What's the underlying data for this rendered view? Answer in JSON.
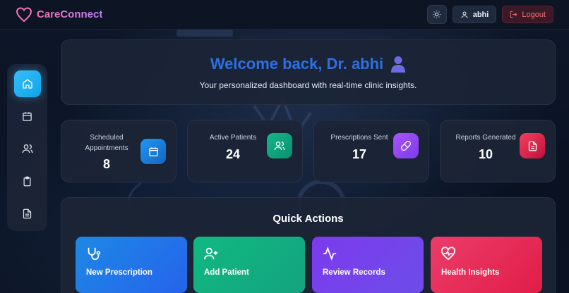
{
  "header": {
    "brand": "CareConnect",
    "user_label": "abhi",
    "logout_label": "Logout"
  },
  "sidebar": {
    "items": [
      {
        "icon": "home-icon",
        "active": true
      },
      {
        "icon": "calendar-icon",
        "active": false
      },
      {
        "icon": "users-icon",
        "active": false
      },
      {
        "icon": "clipboard-icon",
        "active": false
      },
      {
        "icon": "file-text-icon",
        "active": false
      }
    ]
  },
  "welcome": {
    "title": "Welcome back, Dr. abhi",
    "subtitle": "Your personalized dashboard with real-time clinic insights."
  },
  "stats": [
    {
      "label": "Scheduled Appointments",
      "value": "8",
      "icon": "calendar-icon",
      "color": "#1e88e5"
    },
    {
      "label": "Active Patients",
      "value": "24",
      "icon": "users-icon",
      "color": "#0fa77d"
    },
    {
      "label": "Prescriptions Sent",
      "value": "17",
      "icon": "pill-icon",
      "color": "#8b5cf6"
    },
    {
      "label": "Reports Generated",
      "value": "10",
      "icon": "file-text-icon",
      "color": "#e11d48"
    }
  ],
  "quick_actions": {
    "title": "Quick Actions",
    "items": [
      {
        "label": "New Prescription",
        "icon": "stethoscope-icon",
        "color": "#2563eb"
      },
      {
        "label": "Add Patient",
        "icon": "user-plus-icon",
        "color": "#10b981"
      },
      {
        "label": "Review Records",
        "icon": "activity-icon",
        "color": "#7c3aed"
      },
      {
        "label": "Health Insights",
        "icon": "heart-pulse-icon",
        "color": "#e11d48"
      }
    ]
  },
  "colors": {
    "accent": "#38bdf8",
    "title_blue": "#2f6fe0",
    "brand_gradient_start": "#f472b6",
    "brand_gradient_end": "#c084fc",
    "logout_red": "#f87171"
  }
}
